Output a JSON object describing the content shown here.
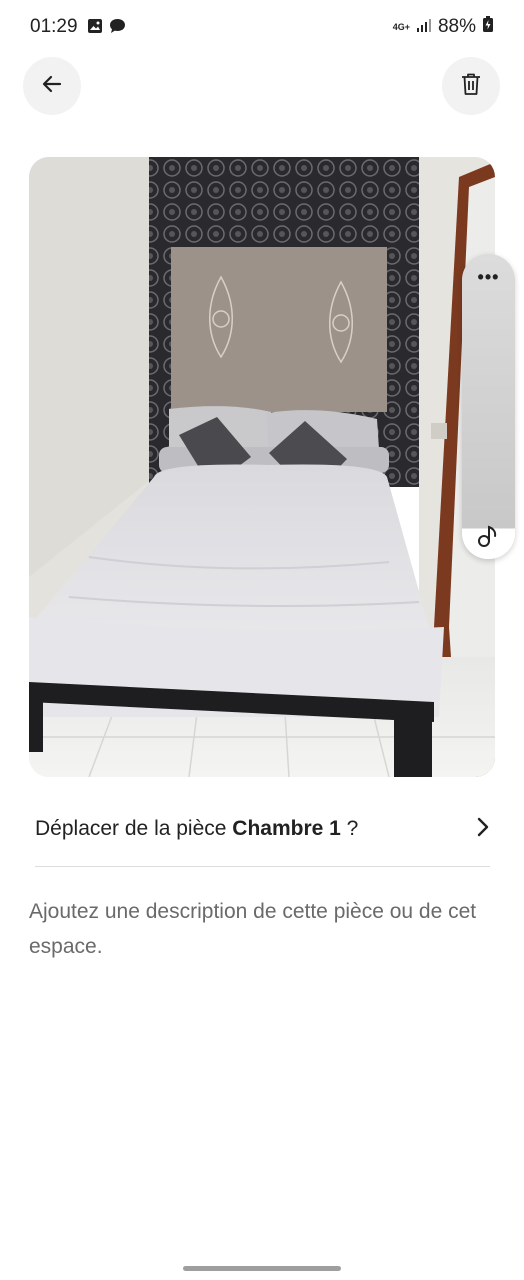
{
  "status_bar": {
    "time": "01:29",
    "network": "4G+",
    "battery": "88%",
    "icons": [
      "image-notification-icon",
      "chat-notification-icon",
      "signal-icon",
      "battery-icon"
    ]
  },
  "header": {
    "back_icon": "arrow-left-icon",
    "delete_icon": "trash-icon"
  },
  "photo": {
    "subject": "bedroom-photo"
  },
  "side_panel": {
    "menu_glyph": "•••",
    "icons": [
      "more-icon",
      "music-note-icon"
    ]
  },
  "move_row": {
    "prefix": "Déplacer de la pièce ",
    "room": "Chambre 1",
    "suffix": " ?",
    "chevron_icon": "chevron-right-icon"
  },
  "description_placeholder": "Ajoutez une description de cette pièce ou de cet espace.",
  "colors": {
    "text": "#222222",
    "muted": "#6a6a6a",
    "button_bg": "#f2f2f2",
    "divider": "#dddddd"
  }
}
